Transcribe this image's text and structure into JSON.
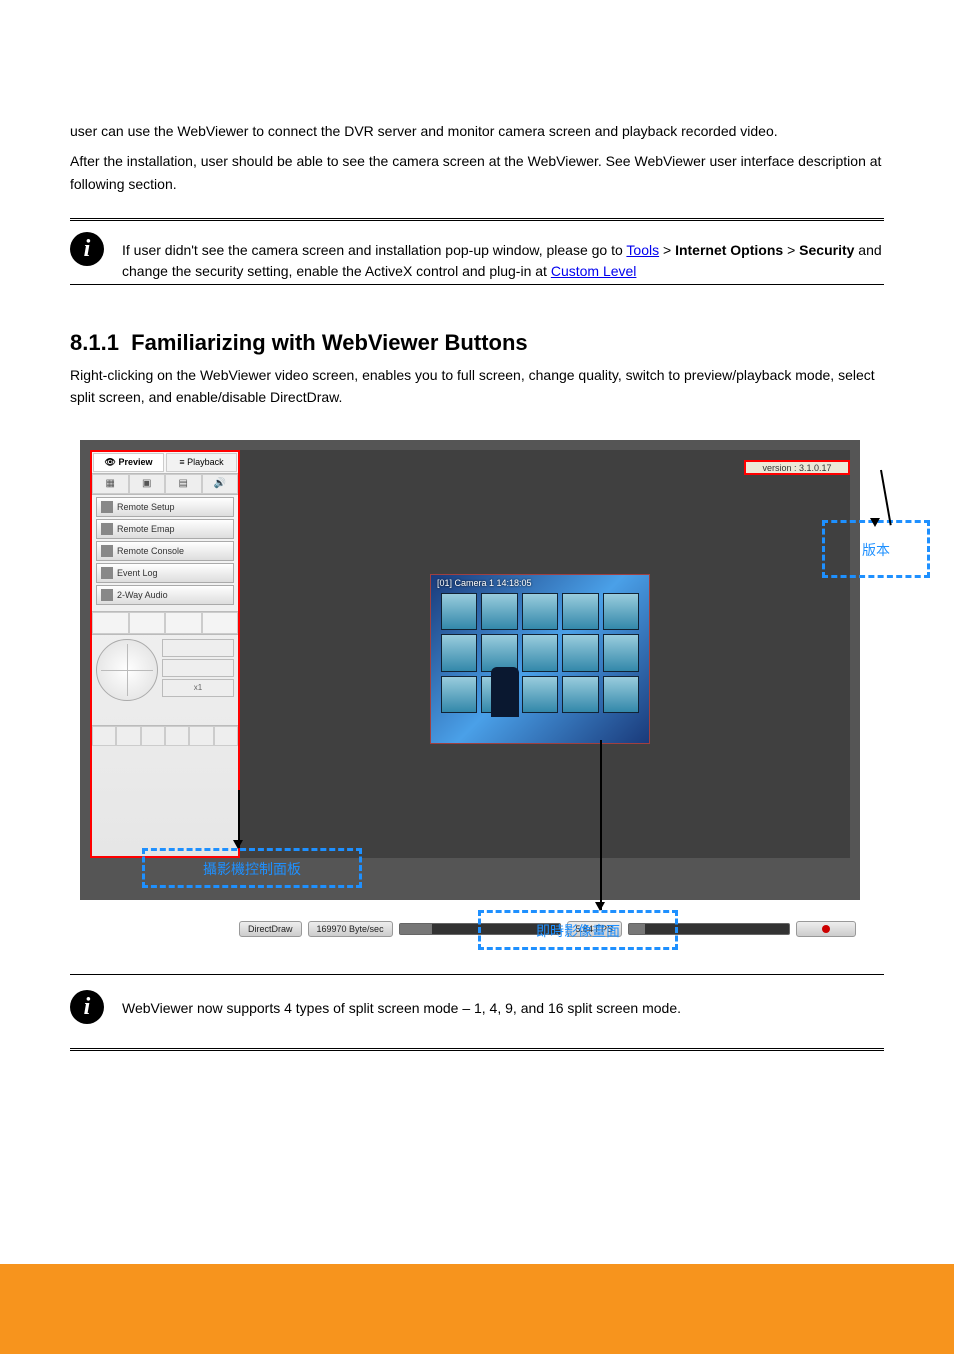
{
  "intro": {
    "p1": "user can use the WebViewer to connect the DVR server and monitor camera screen and playback recorded video.",
    "p2": "After the installation, user should be able to see the camera screen at the WebViewer. See WebViewer user interface description at following section."
  },
  "note1": {
    "prefix": "If user didn't see the camera screen and installation pop-up window, please go to ",
    "linkText": "Tools",
    "mid": " > ",
    "bold": "Internet Options",
    "mid2": " > ",
    "bold2": "Security",
    "tail": " and change the security setting, enable the ActiveX control and plug-in at ",
    "linkText2": "Custom Level"
  },
  "section": {
    "number": "8.1.1",
    "title": "Familiarizing with WebViewer Buttons",
    "body": "Right-clicking on the WebViewer video screen, enables you to full screen, change quality, switch to preview/playback mode, select split screen, and enable/disable DirectDraw."
  },
  "panel": {
    "previewTab": "Preview",
    "playbackTab": "Playback",
    "remoteSetup": "Remote Setup",
    "remoteEmap": "Remote Emap",
    "remoteConsole": "Remote Console",
    "eventLog": "Event Log",
    "twoWayAudio": "2-Way Audio",
    "ptzSpeed": "x1"
  },
  "versionBox": "version : 3.1.0.17",
  "videoOverlay": "[01]  Camera  1  14:18:05",
  "status": {
    "mode": "DirectDraw",
    "rate": "169970 Byte/sec",
    "fps": "5.84 FPS"
  },
  "callouts": {
    "version": "版本",
    "panel": "攝影機控制面板",
    "video": "即時影像畫面"
  },
  "note2": {
    "text": "WebViewer now supports 4 types of split screen mode – 1, 4, 9, and 16 split screen mode."
  }
}
